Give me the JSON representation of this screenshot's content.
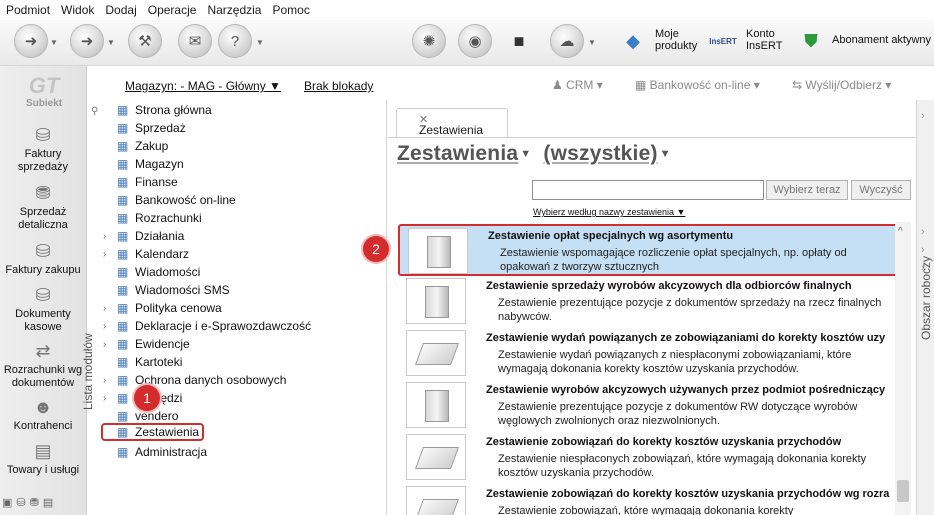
{
  "menu": [
    "Podmiot",
    "Widok",
    "Dodaj",
    "Operacje",
    "Narzędzia",
    "Pomoc"
  ],
  "toolbar": {
    "moje_produkty": "Moje\nprodukty",
    "konto": "Konto\nInsERT",
    "abonament": "Abonament aktywny",
    "moje_produkty_l1": "Moje",
    "moje_produkty_l2": "produkty",
    "konto_l1": "Konto",
    "konto_l2": "InsERT",
    "insert_logo": "InsERT"
  },
  "left_nav": {
    "logo": "Subiekt",
    "items": [
      {
        "label": "Faktury sprzedaży",
        "icon": "coins-icon"
      },
      {
        "label": "Sprzedaż detaliczna",
        "icon": "cash-register-icon"
      },
      {
        "label": "Faktury zakupu",
        "icon": "coins-icon"
      },
      {
        "label": "Dokumenty kasowe",
        "icon": "coins-icon"
      },
      {
        "label": "Rozrachunki wg dokumentów",
        "icon": "settlement-icon"
      },
      {
        "label": "Kontrahenci",
        "icon": "person-icon"
      },
      {
        "label": "Towary i usługi",
        "icon": "goods-icon"
      }
    ]
  },
  "infobar": {
    "magazyn": "Magazyn: - MAG - Główny",
    "blokada": "Brak blokady",
    "crm": "CRM",
    "bankowosc": "Bankowość on-line",
    "wyslij": "Wyślij/Odbierz"
  },
  "modules": {
    "panel_label": "Lista modułów",
    "items": [
      {
        "label": "Strona główna",
        "expandable": false
      },
      {
        "label": "Sprzedaż",
        "expandable": false
      },
      {
        "label": "Zakup",
        "expandable": false
      },
      {
        "label": "Magazyn",
        "expandable": false
      },
      {
        "label": "Finanse",
        "expandable": false
      },
      {
        "label": "Bankowość on-line",
        "expandable": false
      },
      {
        "label": "Rozrachunki",
        "expandable": false
      },
      {
        "label": "Działania",
        "expandable": true
      },
      {
        "label": "Kalendarz",
        "expandable": true
      },
      {
        "label": "Wiadomości",
        "expandable": false
      },
      {
        "label": "Wiadomości SMS",
        "expandable": false
      },
      {
        "label": "Polityka cenowa",
        "expandable": true
      },
      {
        "label": "Deklaracje i e-Sprawozdawczość",
        "expandable": true
      },
      {
        "label": "Ewidencje",
        "expandable": true
      },
      {
        "label": "Kartoteki",
        "expandable": false
      },
      {
        "label": "Ochrona danych osobowych",
        "expandable": true
      },
      {
        "label": "Narzędzi",
        "expandable": true
      },
      {
        "label": "vendero",
        "expandable": false
      },
      {
        "label": "Zestawienia",
        "expandable": false
      },
      {
        "label": "Administracja",
        "expandable": false
      }
    ]
  },
  "content": {
    "tab": "Zestawienia",
    "heading_1": "Zestawienia",
    "heading_2": "(wszystkie)",
    "wybierz_teraz": "Wybierz teraz",
    "wyczysc": "Wyczyść",
    "sort": "Wybierz według nazwy zestawienia",
    "rows": [
      {
        "title": "Zestawienie opłat specjalnych wg asortymentu",
        "desc": "Zestawienie wspomagające rozliczenie opłat specjalnych, np. opłaty od opakowań z tworzyw sztucznych",
        "selected": true,
        "icon": "box-icon"
      },
      {
        "title": "Zestawienie sprzedaży wyrobów akcyzowych dla odbiorców finalnych",
        "desc": "Zestawienie prezentujące pozycje z dokumentów sprzedaży na rzecz finalnych nabywców.",
        "selected": false,
        "icon": "box-icon"
      },
      {
        "title": "Zestawienie wydań powiązanych ze zobowiązaniami do korekty kosztów uzy",
        "desc": "Zestawienie wydań powiązanych z niespłaconymi zobowiązaniami, które wymagają dokonania korekty kosztów uzyskania przychodów.",
        "selected": false,
        "icon": "sheets-icon"
      },
      {
        "title": "Zestawienie wyrobów akcyzowych używanych przez podmiot pośredniczący",
        "desc": "Zestawienie prezentujące pozycje z dokumentów RW dotyczące wyrobów węglowych zwolnionych oraz niezwolnionych.",
        "selected": false,
        "icon": "box-icon"
      },
      {
        "title": "Zestawienie zobowiązań do korekty kosztów uzyskania przychodów",
        "desc": "Zestawienie niespłaconych zobowiązań, które wymagają dokonania korekty kosztów uzyskania przychodów.",
        "selected": false,
        "icon": "sheets-icon"
      },
      {
        "title": "Zestawienie zobowiązań do korekty kosztów uzyskania przychodów wg rozra",
        "desc": "Zestawienie zobowiązań, które wymagają dokonania korekty",
        "selected": false,
        "icon": "printer-icon"
      }
    ]
  },
  "right_panel": {
    "label": "Obszar roboczy"
  },
  "badges": [
    "1",
    "2"
  ],
  "colors": {
    "selection": "#c5dff5",
    "highlight": "#d42c2c"
  }
}
